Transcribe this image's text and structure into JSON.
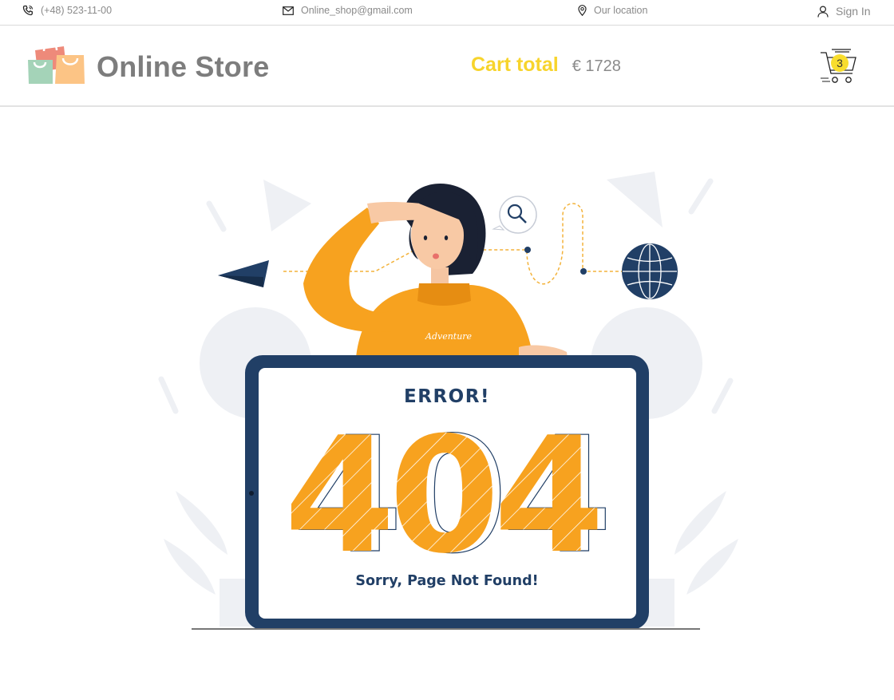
{
  "topbar": {
    "phone": "(+48) 523-11-00",
    "email": "Online_shop@gmail.com",
    "location": "Our location",
    "sign_in": "Sign In"
  },
  "header": {
    "logo_text": "Online Store",
    "cart_total_label": "Cart total",
    "cart_total_value": "€ 1728",
    "cart_count": "3"
  },
  "error": {
    "title": "ERROR!",
    "code": "404",
    "message": "Sorry, Page Not Found!",
    "shirt_text": "Adventure"
  },
  "colors": {
    "accent_yellow": "#f7d42c",
    "orange": "#f7a21f",
    "navy": "#213f66",
    "text_gray": "#7d7d7d"
  }
}
